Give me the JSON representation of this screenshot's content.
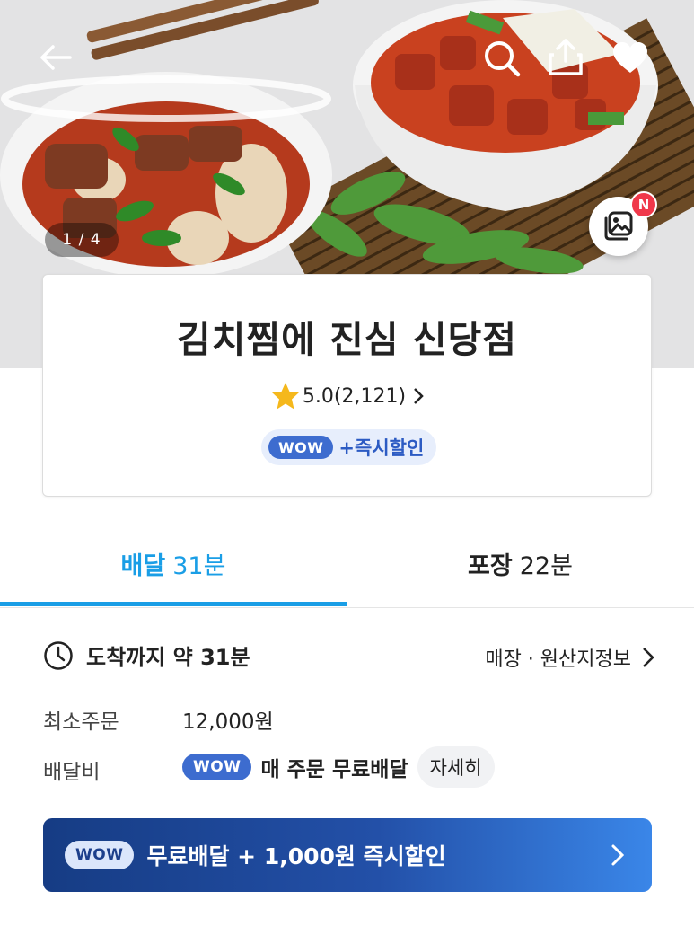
{
  "hero": {
    "image_counter": "1 / 4",
    "new_badge": "N",
    "icons": [
      "back-arrow-icon",
      "search-icon",
      "share-icon",
      "heart-icon",
      "gallery-icon"
    ]
  },
  "store": {
    "name": "김치찜에 진심 신당점",
    "rating": "5.0",
    "review_count": "(2,121)",
    "wow_badge": "WOW",
    "promo": "+즉시할인"
  },
  "tabs": [
    {
      "label": "배달",
      "time": "31분"
    },
    {
      "label": "포장",
      "time": "22분"
    }
  ],
  "info": {
    "eta_label": "도착까지 약 31분",
    "origin_link": "매장 · 원산지정보",
    "min_order_label": "최소주문",
    "min_order_value": "12,000원",
    "delivery_fee_label": "배달비",
    "wow_badge": "WOW",
    "delivery_fee_value": "매 주문 무료배달",
    "detail_button": "자세히"
  },
  "banner": {
    "wow_badge": "WOW",
    "text": "무료배달 + 1,000원 즉시할인"
  },
  "colors": {
    "accent_blue": "#1a9ee6",
    "wow_blue": "#3d6ccf",
    "banner_dark": "#163c84",
    "banner_light": "#3a86e8",
    "star": "#f5b81c",
    "new_dot": "#f0384a"
  }
}
